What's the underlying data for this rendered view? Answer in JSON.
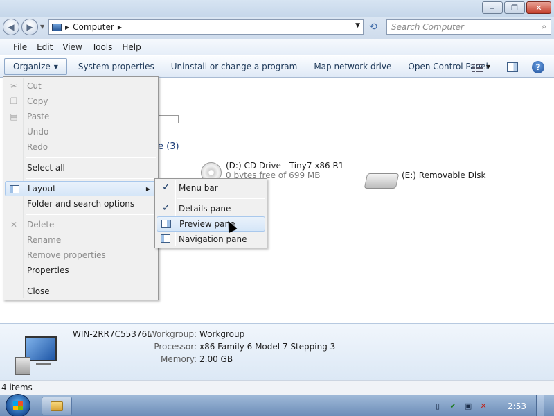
{
  "window": {
    "controls": {
      "minimize": "‒",
      "maximize": "❐",
      "close": "✕"
    }
  },
  "address": {
    "location": "Computer",
    "search_placeholder": "Search Computer"
  },
  "menubar": [
    "File",
    "Edit",
    "View",
    "Tools",
    "Help"
  ],
  "commandbar": {
    "organize": "Organize",
    "items": [
      "System properties",
      "Uninstall or change a program",
      "Map network drive",
      "Open Control Panel"
    ]
  },
  "content": {
    "group_header": "e (3)",
    "drives": [
      {
        "name": "(D:) CD Drive - Tiny7 x86 R1",
        "detail": "0 bytes free of 699 MB"
      },
      {
        "name": "(E:) Removable Disk",
        "detail": ""
      }
    ]
  },
  "organize_menu": {
    "items": [
      {
        "label": "Cut",
        "icon": "scissors-icon",
        "disabled": true
      },
      {
        "label": "Copy",
        "icon": "copy-icon",
        "disabled": true
      },
      {
        "label": "Paste",
        "icon": "paste-icon",
        "disabled": true
      },
      {
        "label": "Undo",
        "disabled": true
      },
      {
        "label": "Redo",
        "disabled": true
      },
      {
        "label": "Select all",
        "disabled": false
      },
      {
        "label": "Layout",
        "icon": "layout-icon",
        "disabled": false,
        "submenu": true
      },
      {
        "label": "Folder and search options",
        "disabled": false
      },
      {
        "label": "Delete",
        "icon": "delete-icon",
        "disabled": true
      },
      {
        "label": "Rename",
        "disabled": true
      },
      {
        "label": "Remove properties",
        "disabled": true
      },
      {
        "label": "Properties",
        "disabled": false
      },
      {
        "label": "Close",
        "disabled": false
      }
    ]
  },
  "layout_submenu": {
    "items": [
      {
        "label": "Menu bar",
        "checked": true
      },
      {
        "label": "Details pane",
        "checked": true
      },
      {
        "label": "Preview pane",
        "checked": false,
        "highlighted": true
      },
      {
        "label": "Navigation pane",
        "checked": false
      }
    ]
  },
  "details": {
    "computer_name": "WIN-2RR7C55376L",
    "rows": [
      {
        "label": "Workgroup:",
        "value": "Workgroup"
      },
      {
        "label": "Processor:",
        "value": "x86 Family 6 Model 7 Stepping 3"
      },
      {
        "label": "Memory:",
        "value": "2.00 GB"
      }
    ]
  },
  "status": {
    "items_count": "4 items"
  },
  "taskbar": {
    "clock": "2:53"
  }
}
